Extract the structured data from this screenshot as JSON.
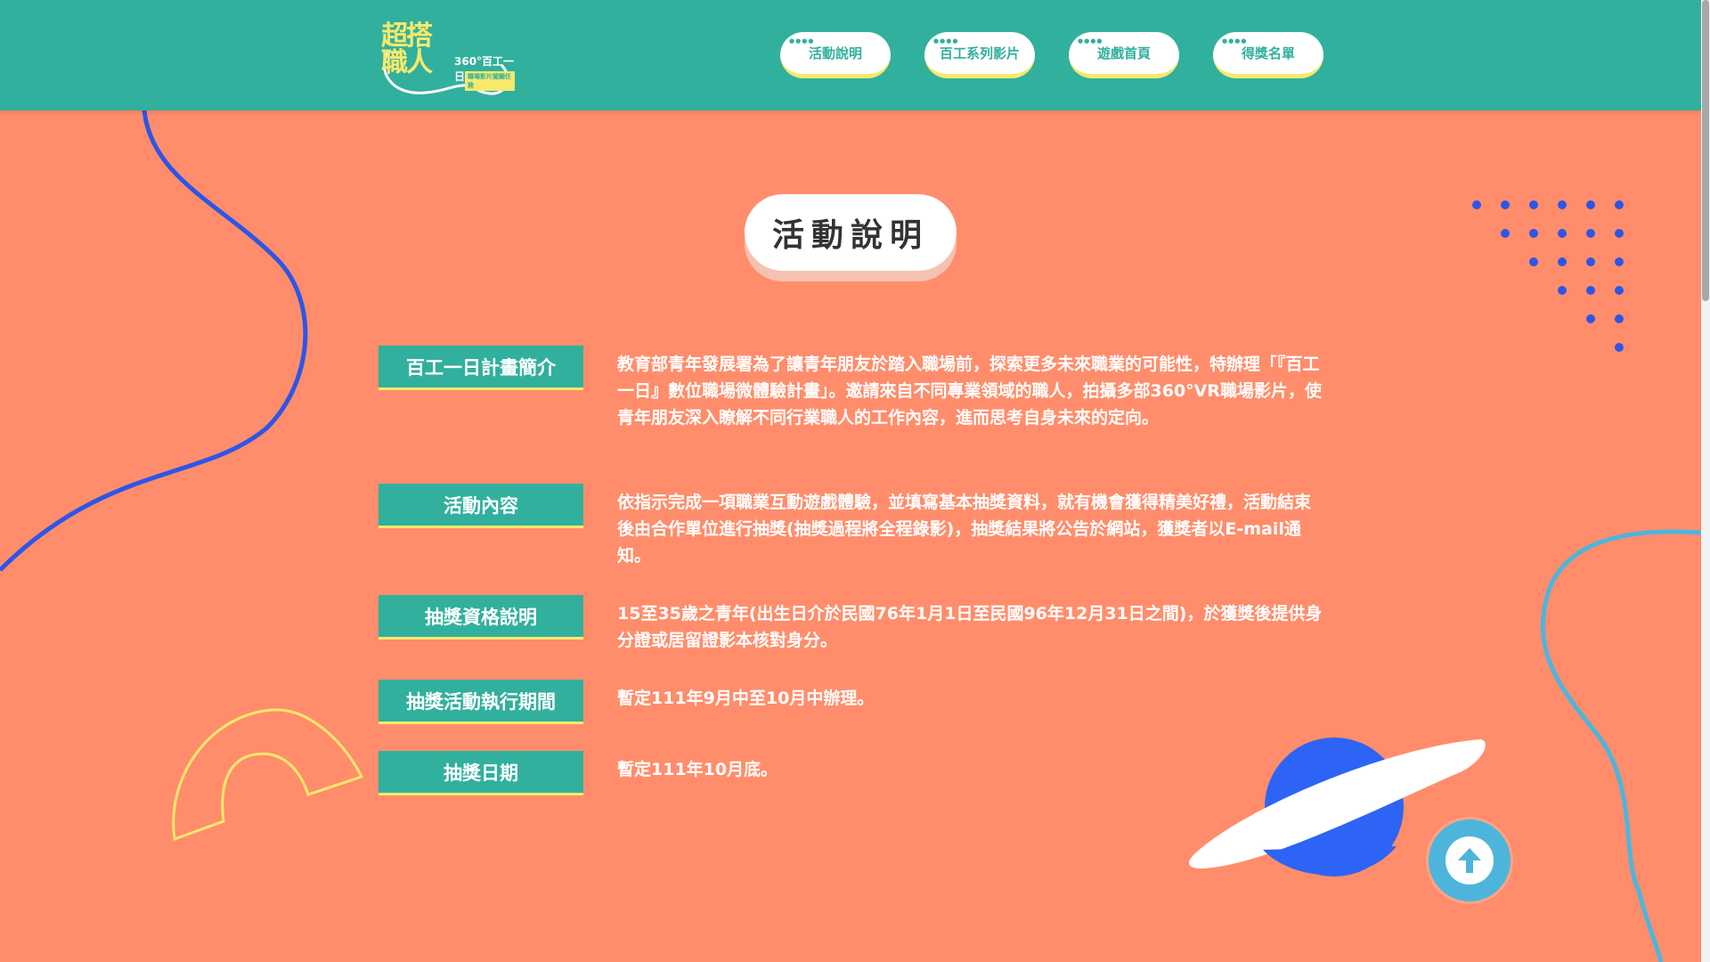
{
  "header": {
    "logo": {
      "line1": "超搭",
      "line2": "職人",
      "sub": "360°百工一日",
      "tag": "職場影片闖關任務"
    },
    "nav": [
      {
        "label": "活動說明"
      },
      {
        "label": "百工系列影片"
      },
      {
        "label": "遊戲首頁"
      },
      {
        "label": "得獎名單"
      }
    ]
  },
  "main": {
    "title": "活動說明",
    "sections": [
      {
        "label": "百工一日計畫簡介",
        "text": "教育部青年發展署為了讓青年朋友於踏入職場前，探索更多未來職業的可能性，特辦理「『百工一日』數位職場微體驗計畫」。邀請來自不同專業領域的職人，拍攝多部360°VR職場影片，使青年朋友深入瞭解不同行業職人的工作內容，進而思考自身未來的定向。"
      },
      {
        "label": "活動內容",
        "text": "依指示完成一項職業互動遊戲體驗，並填寫基本抽獎資料，就有機會獲得精美好禮，活動結束後由合作單位進行抽獎(抽獎過程將全程錄影)，抽獎結果將公告於網站，獲獎者以E-mail通知。"
      },
      {
        "label": "抽獎資格說明",
        "text": "15至35歲之青年(出生日介於民國76年1月1日至民國96年12月31日之間)，於獲獎後提供身分證或居留證影本核對身分。"
      },
      {
        "label": "抽獎活動執行期間",
        "text": "暫定111年9月中至10月中辦理。"
      },
      {
        "label": "抽獎日期",
        "text": "暫定111年10月底。"
      }
    ]
  },
  "icons": {
    "back_to_top": "arrow-up-icon"
  },
  "colors": {
    "background": "#FF8D6B",
    "header": "#31B09D",
    "accent_yellow": "#F6E96C",
    "planet_blue": "#2D64F5",
    "line_blue": "#2D55E8",
    "light_blue": "#4DB5DC"
  }
}
